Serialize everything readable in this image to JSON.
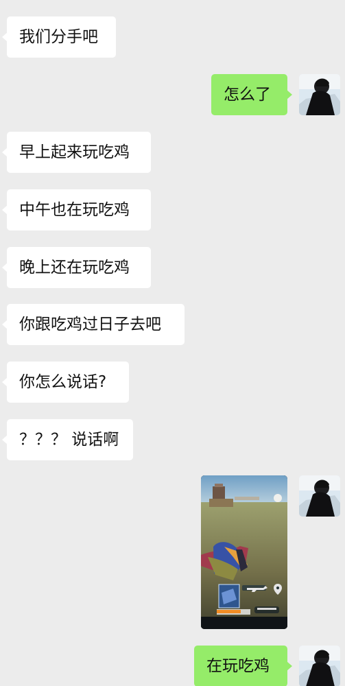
{
  "messages": [
    {
      "side": "left",
      "text": "我们分手吧"
    },
    {
      "side": "right",
      "text": "怎么了"
    },
    {
      "side": "left",
      "text": "早上起来玩吃鸡"
    },
    {
      "side": "left",
      "text": "中午也在玩吃鸡"
    },
    {
      "side": "left",
      "text": "晚上还在玩吃鸡"
    },
    {
      "side": "left",
      "text": "你跟吃鸡过日子去吧"
    },
    {
      "side": "left",
      "text": "你怎么说话?"
    },
    {
      "side": "left",
      "text": "？？？ 说话啊"
    },
    {
      "side": "right",
      "type": "image"
    },
    {
      "side": "right",
      "text": "在玩吃鸡"
    }
  ],
  "colors": {
    "chat_background": "#ececec",
    "incoming_bubble": "#ffffff",
    "outgoing_bubble": "#95ec69"
  },
  "icons": {
    "avatar": "avatar-icon",
    "location": "location-pin-icon",
    "rifle": "rifle-icon"
  }
}
